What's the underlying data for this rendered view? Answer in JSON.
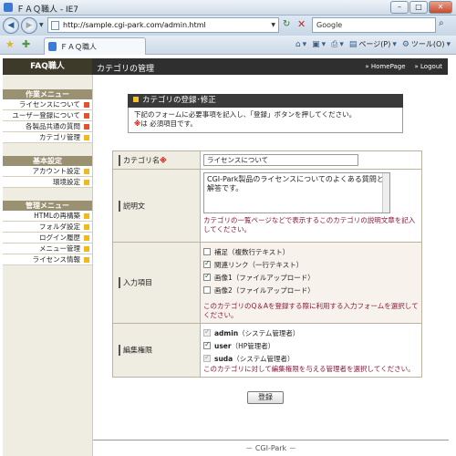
{
  "window": {
    "title": "ＦＡＱ職人 - IE7"
  },
  "address": {
    "url": "http://sample.cgi-park.com/admin.html",
    "search_placeholder": "Google"
  },
  "toolbar": {
    "tab_label": "ＦＡＱ職人",
    "page_menu": "ページ(P)",
    "tools_menu": "ツール(O)"
  },
  "header": {
    "brand": "FAQ職人",
    "page_title": "カテゴリの管理",
    "links": [
      "HomePage",
      "Logout"
    ]
  },
  "sidebar": {
    "sections": [
      {
        "title": "作業メニュー",
        "items": [
          {
            "label": "ライセンスについて",
            "mark": "#e0532c"
          },
          {
            "label": "ユーザー登録について",
            "mark": "#e0532c"
          },
          {
            "label": "各製品共通の質問",
            "mark": "#e0532c"
          },
          {
            "label": "カテゴリ管理",
            "mark": "#f0b91f"
          }
        ]
      },
      {
        "title": "基本設定",
        "items": [
          {
            "label": "アカウント設定",
            "mark": "#f0b91f"
          },
          {
            "label": "環境設定",
            "mark": "#f0b91f"
          }
        ]
      },
      {
        "title": "管理メニュー",
        "items": [
          {
            "label": "HTMLの再構築",
            "mark": "#f0b91f"
          },
          {
            "label": "フォルダ設定",
            "mark": "#f0b91f"
          },
          {
            "label": "ログイン履歴",
            "mark": "#f0b91f"
          },
          {
            "label": "メニュー管理",
            "mark": "#f0b91f"
          },
          {
            "label": "ライセンス情報",
            "mark": "#f0b91f"
          }
        ]
      }
    ]
  },
  "notice": {
    "title": "カテゴリの登録･修正",
    "line1": "下記のフォームに必要事項を記入し、「登録」ボタンを押してください。",
    "req_mark": "※",
    "line2": "は 必須項目です。"
  },
  "form": {
    "name_label": "カテゴリ名",
    "name_req": "※",
    "name_value": "ライセンスについて",
    "desc_label": "説明文",
    "desc_value": "CGI-Park製品のライセンスについてのよくある質問と解答です。",
    "desc_hint": "カテゴリの一覧ページなどで表示するこのカテゴリの説明文章を記入してください。",
    "fields_label": "入力項目",
    "fields": [
      {
        "label": "補足（複数行テキスト）",
        "checked": false
      },
      {
        "label": "関連リンク（一行テキスト）",
        "checked": true
      },
      {
        "label": "画像1（ファイルアップロード）",
        "checked": true
      },
      {
        "label": "画像2（ファイルアップロード）",
        "checked": false
      }
    ],
    "fields_hint": "このカテゴリのQ＆Aを登録する際に利用する入力フォームを選択してください。",
    "perm_label": "編集権限",
    "perms": [
      {
        "user": "admin",
        "desc": "（システム管理者）",
        "checked": true,
        "disabled": true
      },
      {
        "user": "user",
        "desc": "（HP管理者）",
        "checked": true,
        "disabled": false
      },
      {
        "user": "suda",
        "desc": "（システム管理者）",
        "checked": true,
        "disabled": true
      }
    ],
    "perm_hint": "このカテゴリに対して編集権限を与える管理者を選択してください。",
    "submit": "登録"
  },
  "footer": {
    "text": "－ CGI-Park －"
  }
}
